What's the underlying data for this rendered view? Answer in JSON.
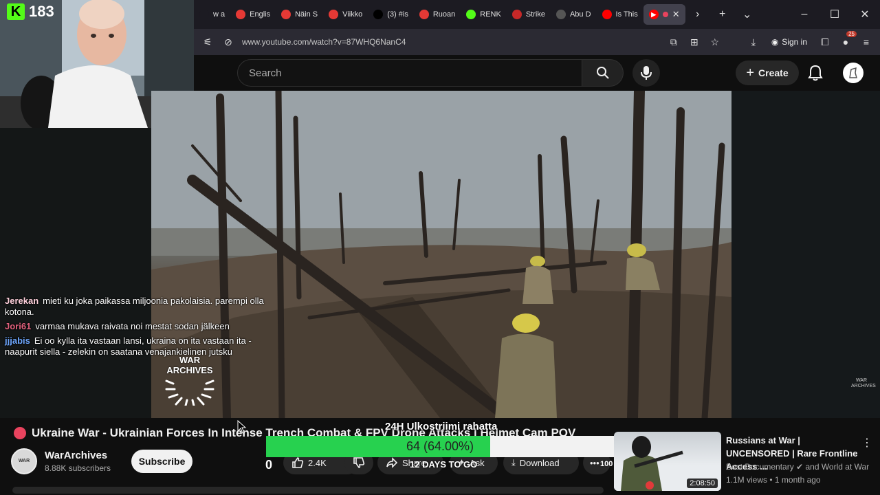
{
  "stream": {
    "viewer_count": "183"
  },
  "browser": {
    "tabs": [
      {
        "label": "w a",
        "color": "#1c1b22",
        "icon": "blank-icon"
      },
      {
        "label": "Englis",
        "color": "#e53935",
        "icon": "news-icon"
      },
      {
        "label": "Näin S",
        "color": "#e53935",
        "icon": "news-icon"
      },
      {
        "label": "Viikko",
        "color": "#e53935",
        "icon": "news-icon"
      },
      {
        "label": "(3) #is",
        "color": "#000000",
        "icon": "x-icon"
      },
      {
        "label": "Ruoan",
        "color": "#e53935",
        "icon": "news-icon"
      },
      {
        "label": "RENK",
        "color": "#53fc18",
        "icon": "kick-icon"
      },
      {
        "label": "Strike",
        "color": "#c62828",
        "icon": "strike-icon"
      },
      {
        "label": "Abu D",
        "color": "#555555",
        "icon": "inv-icon"
      },
      {
        "label": "Is This",
        "color": "#ff0000",
        "icon": "youtube-icon"
      }
    ],
    "url": "www.youtube.com/watch?v=87WHQ6NanC4",
    "signin_label": "Sign in",
    "extension_badge": "25"
  },
  "youtube": {
    "search_placeholder": "Search",
    "create_label": "Create"
  },
  "chat": [
    {
      "user": "Jerekan",
      "color": "#ffd1dc",
      "text": "mieti ku joka paikassa miljoonia pakolaisia. parempi olla kotona."
    },
    {
      "user": "Jori61",
      "color": "#e2627e",
      "text": "varmaa mukava raivata noi mestat sodan jälkeen"
    },
    {
      "user": "jjjabis",
      "color": "#6fa8ff",
      "text": "Ei oo kylla ita vastaan lansi, ukraina on ita vastaan ita - naapurit siella - zelekin on saatana venajankielinen jutsku"
    }
  ],
  "watermark": {
    "line1": "WAR",
    "line2": "ARCHIVES"
  },
  "video": {
    "title": "Ukraine War - Ukrainian Forces In Intense Trench Combat & FPV Drone Attacks | Helmet Cam POV",
    "channel": "WarArchives",
    "subscribers": "8.88K subscribers",
    "subscribe_label": "Subscribe",
    "likes": "2.4K",
    "share_label": "Share",
    "ask_label": "Ask",
    "download_label": "Download",
    "more_count": "100",
    "counter": "0"
  },
  "goal": {
    "label": "24H Ulkostriimi rahatta",
    "value_text": "64 (64.00%)",
    "progress": 0.64,
    "days_left": "12 DAYS TO GO",
    "fill_color": "#27d14f"
  },
  "recommendation": {
    "title": "Russians at War | UNCENSORED | Rare Frontline Access ...",
    "channel": "Best Documentary",
    "channel_extra": "and World at War",
    "meta": "1.1M views • 1 month ago",
    "duration": "2:08:50"
  }
}
